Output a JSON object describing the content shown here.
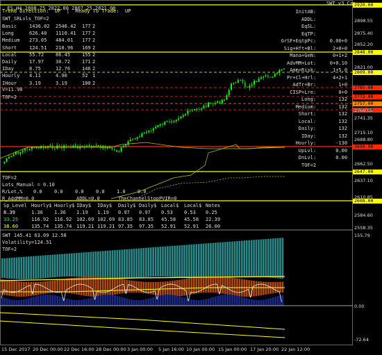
{
  "header": {
    "symbol": "ES,H4",
    "ohlc": "2808.25 2822.00 2807.25 2821.00",
    "right": "SWT v3 Cap"
  },
  "left_info": {
    "trend_label": "Trend Direccion:  UP",
    "ready_label": "Ready To Trade:  UP",
    "swt_label": "SWT_SRLvls_TOF=2",
    "rows": [
      {
        "name": "Basic",
        "a": "1436.02",
        "b": "2546.42",
        "c": "177",
        "d": "2"
      },
      {
        "name": "Long",
        "a": "626.40",
        "b": "1110.41",
        "c": "177",
        "d": "2"
      },
      {
        "name": "Medium",
        "a": "273.05",
        "b": "484.01",
        "c": "177",
        "d": "2"
      },
      {
        "name": "Short",
        "a": "124.51",
        "b": "210.96",
        "c": "169",
        "d": "2"
      },
      {
        "name": "Local",
        "a": "55.72",
        "b": "86.45",
        "c": "155",
        "d": "2"
      },
      {
        "name": "Daily",
        "a": "17.97",
        "b": "30.72",
        "c": "171",
        "d": "2"
      },
      {
        "name": "IDay",
        "a": "8.75",
        "b": "12.76",
        "c": "146",
        "d": "2"
      },
      {
        "name": "Hourly",
        "a": "4.11",
        "b": "4.90",
        "c": "52",
        "d": "1"
      },
      {
        "name": "IHour",
        "a": "3.19",
        "b": "3.19",
        "c": "100",
        "d": "2"
      }
    ],
    "v_line": "V=11.90",
    "tof": "TOF=2"
  },
  "right_info": [
    {
      "k": "InitAB:",
      "v": ""
    },
    {
      "k": "ADDL:",
      "v": ""
    },
    {
      "k": "EqSL:",
      "v": ""
    },
    {
      "k": "EqTP:",
      "v": ""
    },
    {
      "k": "GrSF+EqtpPc:",
      "v": "0.00+0"
    },
    {
      "k": "Sig+Hft+Bl:",
      "v": "2+0+0"
    },
    {
      "k": "Mana+GeN:",
      "v": "0+1+2"
    },
    {
      "k": "AdvMM+Lot:",
      "v": "0+0.10"
    },
    {
      "k": "Amm+Risk:",
      "v": "1+5.0"
    },
    {
      "k": "Pr+Cl+Hrl:",
      "v": "4+2+1"
    },
    {
      "k": "AdTr+Br:",
      "v": "1+0"
    },
    {
      "k": "CISP+Lre:",
      "v": "0+0"
    },
    {
      "k": "Long:",
      "v": "132"
    },
    {
      "k": "Medium:",
      "v": "132"
    },
    {
      "k": "Short:",
      "v": "132"
    },
    {
      "k": "Local:",
      "v": "132"
    },
    {
      "k": "Daily:",
      "v": "132"
    },
    {
      "k": "IDay:",
      "v": "132"
    },
    {
      "k": "Hourly:",
      "v": "-130"
    },
    {
      "k": "UpLvl:",
      "v": "0.00"
    },
    {
      "k": "DnLvl:",
      "v": "0.00"
    },
    {
      "k": "TOF=2",
      "v": ""
    }
  ],
  "lots_info": {
    "tof": "TOF=2",
    "lots_manual": "Lots_Manual = 0.10",
    "r_lots_label": "R/Lot,%",
    "r_lots_values": [
      "0.0",
      "0.0",
      "0.0",
      "0.0",
      "1.0",
      "0.0"
    ],
    "r_addmm": "R_AddMM=0.0",
    "addl": "ADDL=0.0",
    "channel_stop": "TheChannelStopPVIR=0"
  },
  "level_table": {
    "headers": [
      "Sp_Level",
      "Hourly$",
      "Hourly$",
      "IDay$",
      "IDay$",
      "Daily$",
      "Daily$",
      "Local$",
      "Local$",
      "Notes"
    ],
    "rows": [
      {
        "key": "8.39",
        "values": [
          "1.36",
          "1.36",
          "1.19",
          "1.19",
          "0.97",
          "0.97",
          "0.53",
          "0.53",
          "0.25"
        ]
      },
      {
        "key": "33.25",
        "values": [
          "116.92",
          "116.92",
          "102.69",
          "102.69",
          "83.85",
          "83.85",
          "45.58",
          "45.58",
          "22.39"
        ]
      },
      {
        "key": "38.60",
        "values": [
          "135.74",
          "135.74",
          "119.21",
          "119.21",
          "97.35",
          "97.35",
          "52.91",
          "52.91",
          "26.00"
        ]
      }
    ]
  },
  "price_axis": {
    "tags": [
      {
        "label": "2920.00",
        "bg": "#ffff00",
        "fg": "#000000"
      },
      {
        "label": "2848.00",
        "bg": "#ffff00",
        "fg": "#000000"
      },
      {
        "label": "2809.00",
        "bg": "#ffff00",
        "fg": "#000000"
      },
      {
        "label": "2785.00",
        "bg": "#ff2a00",
        "fg": "#000000"
      },
      {
        "label": "2772.00",
        "bg": "#ff2a00",
        "fg": "#000000"
      },
      {
        "label": "2757.00",
        "bg": "#ff8800",
        "fg": "#000000"
      },
      {
        "label": "2749.00",
        "bg": "#ff2a00",
        "fg": "#000000"
      },
      {
        "label": "2690.00",
        "bg": "#ff2a00",
        "fg": "#000000"
      },
      {
        "label": "2647.00",
        "bg": "#ffff00",
        "fg": "#000000"
      },
      {
        "label": "2608.00",
        "bg": "#ffff00",
        "fg": "#000000"
      }
    ],
    "ticks": [
      "2898.55",
      "2875.40",
      "2852.20",
      "2821.00",
      "2768.05",
      "2741.35",
      "2715.10",
      "2688.80",
      "2662.50",
      "2637.10",
      "2610.85",
      "2584.60",
      "2558.35"
    ]
  },
  "indicator": {
    "title": "SWT 145.41 63.09 12.58",
    "volatility": "Volatility=124.51",
    "tof": "TOF=2",
    "ticks": [
      "155.79",
      "0.00",
      "-72.64"
    ]
  },
  "x_axis": [
    "15 Dec 2017",
    "20 Dec 00:00",
    "22 Dec 16:00",
    "28 Dec 00:00",
    "3 Jan 00:00",
    "5 Jan 16:00",
    "10 Jan 00:00",
    "15 Jan 00:00",
    "17 Jan 20:00",
    "22 Jan 12:00"
  ],
  "colors": {
    "bg": "#000000",
    "bull": "#00ff00",
    "bear": "#00c000",
    "level_yellow": "#ffff00",
    "level_red": "#ff2a00",
    "hist_teal": "#2a8a8a",
    "hist_orange": "#b04a10",
    "hist_blue": "#1a2a8a"
  }
}
